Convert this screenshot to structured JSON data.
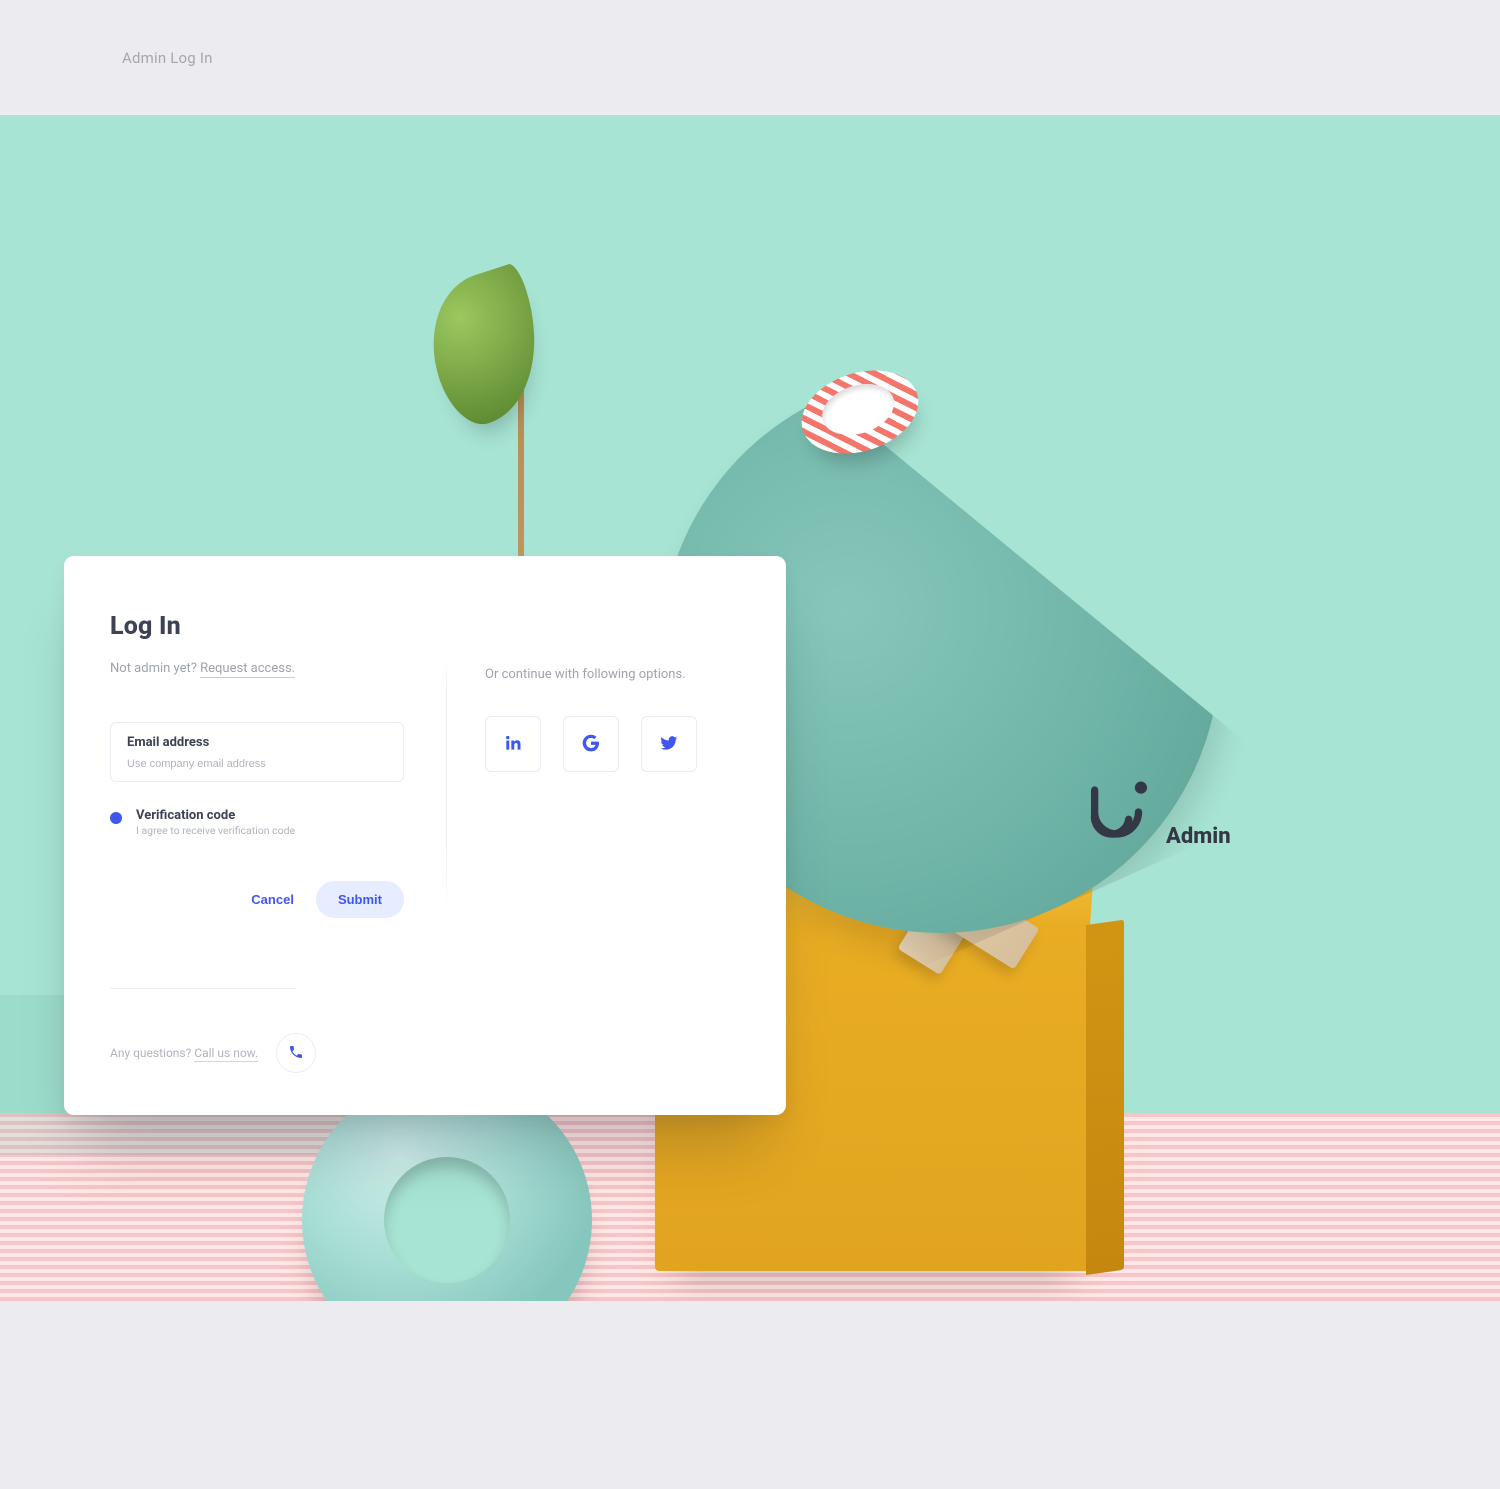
{
  "topbar": {
    "title": "Admin Log In"
  },
  "brand": {
    "label": "Admin"
  },
  "card": {
    "title": "Log In",
    "sub_prefix": "Not admin yet? ",
    "sub_link": "Request access.",
    "email": {
      "label": "Email address",
      "placeholder": "Use company email address",
      "value": ""
    },
    "verify": {
      "title": "Verification code",
      "sub": "I agree to receive verification code"
    },
    "actions": {
      "cancel": "Cancel",
      "submit": "Submit"
    },
    "alt_title": "Or continue with following options.",
    "footer": {
      "prefix": "Any questions? ",
      "link": "Call us now."
    }
  },
  "social": {
    "linkedin": "linkedin-icon",
    "google": "google-icon",
    "twitter": "twitter-icon"
  },
  "colors": {
    "accent": "#3f57f0",
    "mint": "#a7e4d4",
    "yellow": "#e9ad24"
  }
}
